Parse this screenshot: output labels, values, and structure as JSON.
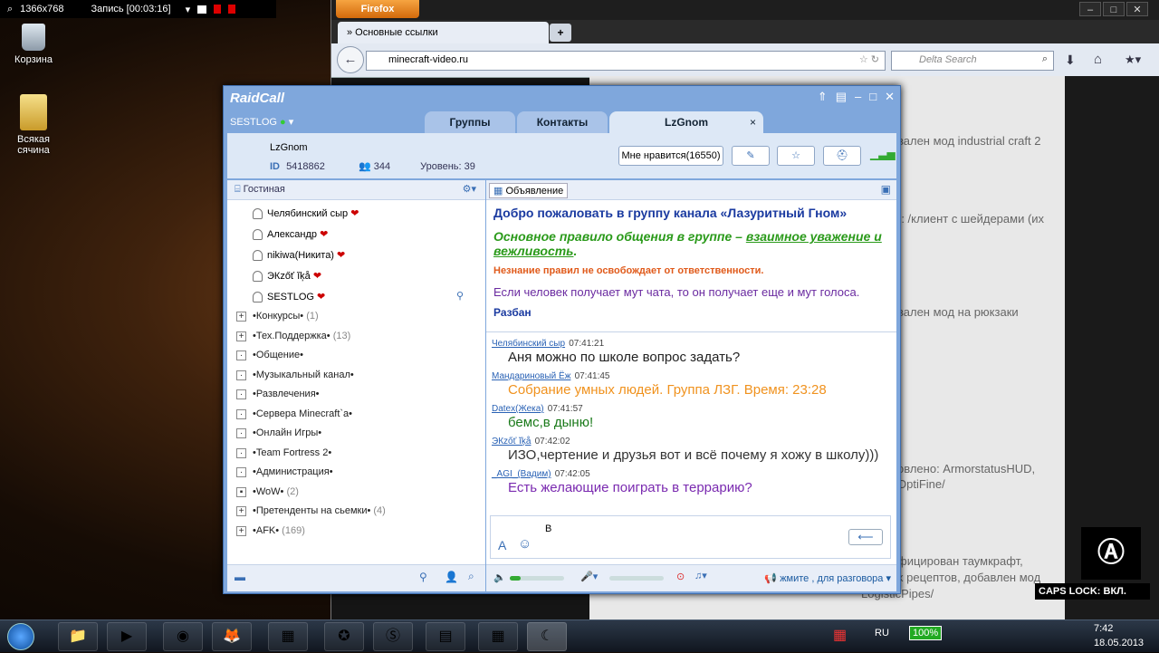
{
  "recorder": {
    "resolution": "1366x768",
    "status": "Запись [00:03:16]"
  },
  "desktop": {
    "icons": [
      {
        "label": "Корзина"
      },
      {
        "label": "Всякая сячина"
      }
    ]
  },
  "firefox": {
    "button": "Firefox",
    "tab_title": "» Основные ссылки",
    "url": "minecraft-video.ru",
    "search_placeholder": "Delta Search",
    "page_lines": [
      "вален мод industrial craft 2",
      "): /клиент с шейдерами (их",
      "вален мод на рюкзаки",
      "овлено: ArmorstatusHUD,",
      "OptiFine/",
      "фицирован таумкрафт,",
      "х рецептов, добавлен мод",
      "LogisticPipes/"
    ]
  },
  "raidcall": {
    "app_title": "RaidCall",
    "user": "SESTLOG",
    "tabs": [
      "Группы",
      "Контакты",
      "LzGnom"
    ],
    "group": {
      "name": "LzGnom",
      "id_label": "ID",
      "id": "5418862",
      "members": "344",
      "level": "Уровень: 39",
      "like": "Мне нравится(16550)"
    },
    "lobby": "Гостиная",
    "members": [
      "Челябинский сыр",
      "Александр",
      "nikiwa(Никита)",
      "ЭКzőť ĭķå",
      "SESTLOG"
    ],
    "groups": [
      {
        "name": "•Конкурсы•",
        "count": "(1)",
        "exp": "+"
      },
      {
        "name": "•Тех.Поддержка•",
        "count": "(13)",
        "exp": "+"
      },
      {
        "name": "•Общение•",
        "count": "",
        "exp": "·"
      },
      {
        "name": "•Музыкальный канал•",
        "count": "",
        "exp": "·"
      },
      {
        "name": "•Развлечения•",
        "count": "",
        "exp": "·"
      },
      {
        "name": "•Сервера Minecraft`a•",
        "count": "",
        "exp": "·"
      },
      {
        "name": "•Онлайн Игры•",
        "count": "",
        "exp": "·"
      },
      {
        "name": "•Team Fortress 2•",
        "count": "",
        "exp": "·"
      },
      {
        "name": "•Администрация•",
        "count": "",
        "exp": "·"
      },
      {
        "name": "•WoW•",
        "count": "(2)",
        "exp": "▪"
      },
      {
        "name": "•Претенденты на сьемки•",
        "count": "(4)",
        "exp": "+"
      },
      {
        "name": "•AFK•",
        "count": "(169)",
        "exp": "+"
      }
    ],
    "announcement_button": "Объявление",
    "announcement": {
      "welcome": "Добро пожаловать в группу канала «Лазуритный Гном»",
      "rule_prefix": "Основное правило общения в группе – ",
      "rule_link": "взаимное уважение и вежливость",
      "rule_suffix": ".",
      "warning": "Незнание правил не освобождает от ответственности.",
      "mute": "Если человек получает мут чата, то он получает еще и мут голоса.",
      "cut": "Разбан"
    },
    "chat": [
      {
        "who": "Челябинский сыр",
        "time": "07:41:21",
        "text": "Аня можно по школе вопрос задать?",
        "color": "#222222"
      },
      {
        "who": "Мандариновый Ёж",
        "time": "07:41:45",
        "text": "Собрание умных людей. Группа ЛЗГ. Время: 23:28",
        "color": "#f0921e"
      },
      {
        "who": "Datex(Жека)",
        "time": "07:41:57",
        "text": "бемс,в дыню!",
        "color": "#1a7a1a"
      },
      {
        "who": "ЭКzőť ĭķå",
        "time": "07:42:02",
        "text": "ИЗО,чертение и друзья вот и всё почему я хожу в школу)))",
        "color": "#333333"
      },
      {
        "who": "_AGI_(Вадим)",
        "time": "07:42:05",
        "text": "Есть желающие поиграть в террарию?",
        "color": "#7a2ab0"
      }
    ],
    "input_value": "В",
    "voice_hint": "жмите , для разговора"
  },
  "caps": "CAPS LOCK: ВКЛ.",
  "tray": {
    "lang": "RU",
    "battery": "100%",
    "time": "7:42",
    "date": "18.05.2013"
  }
}
